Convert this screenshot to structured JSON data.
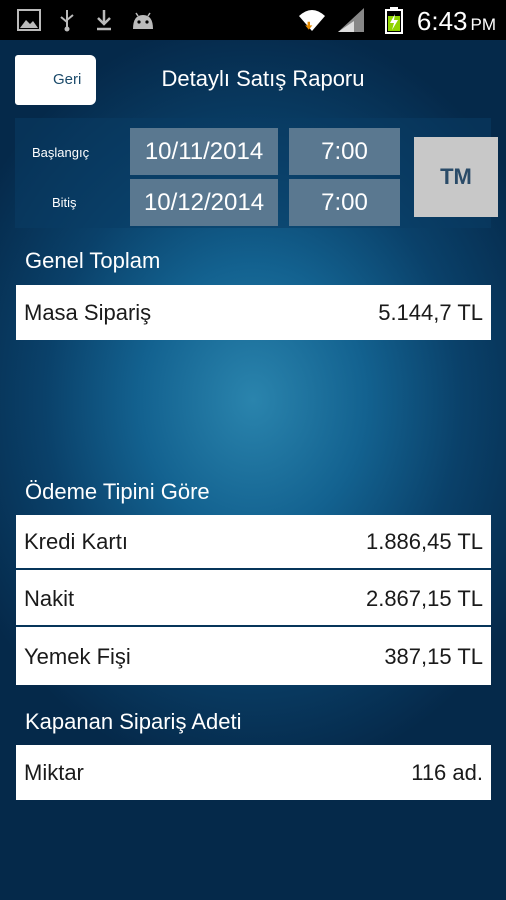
{
  "status_bar": {
    "time": "6:43",
    "ampm": "PM"
  },
  "header": {
    "back_label": "Geri",
    "title": "Detaylı Satış Raporu"
  },
  "date_range": {
    "start_label": "Başlangıç",
    "start_date": "10/11/2014",
    "start_time": "7:00",
    "end_label": "Bitiş",
    "end_date": "10/12/2014",
    "end_time": "7:00",
    "button_label": "TM"
  },
  "general_total": {
    "title": "Genel Toplam",
    "rows": [
      {
        "label": "Masa Sipariş",
        "value": "5.144,7 TL"
      }
    ]
  },
  "by_payment": {
    "title": "Ödeme Tipini Göre",
    "rows": [
      {
        "label": "Kredi Kartı",
        "value": "1.886,45 TL"
      },
      {
        "label": "Nakit",
        "value": "2.867,15 TL"
      },
      {
        "label": "Yemek Fişi",
        "value": "387,15 TL"
      }
    ]
  },
  "closed_orders": {
    "title": "Kapanan Sipariş Adeti",
    "rows": [
      {
        "label": "Miktar",
        "value": "116 ad."
      }
    ]
  },
  "colors": {
    "background": "#03263f",
    "accent": "#136290",
    "field": "#5a7890",
    "button": "#c8c8c8"
  }
}
